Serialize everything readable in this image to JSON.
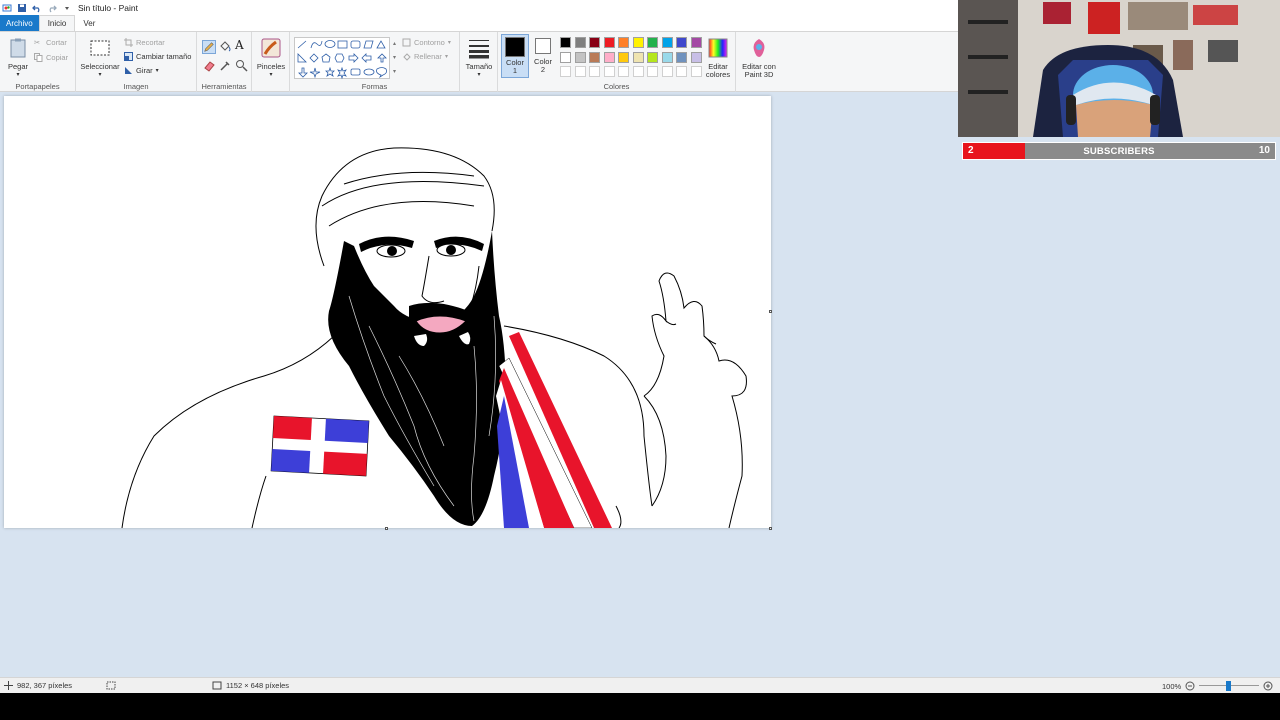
{
  "window": {
    "title": "Sin título - Paint"
  },
  "tabs": [
    {
      "label": "Archivo"
    },
    {
      "label": "Inicio"
    },
    {
      "label": "Ver"
    }
  ],
  "ribbon": {
    "portapapeles": {
      "label": "Portapapeles",
      "paste": "Pegar",
      "cut": "Cortar",
      "copy": "Copiar"
    },
    "imagen": {
      "label": "Imagen",
      "select": "Seleccionar",
      "crop": "Recortar",
      "resize": "Cambiar tamaño",
      "rotate": "Girar"
    },
    "herramientas": {
      "label": "Herramientas"
    },
    "pinceles": {
      "label": "Pinceles"
    },
    "formas": {
      "label": "Formas",
      "outline": "Contorno",
      "fill": "Rellenar"
    },
    "tamano": {
      "label": "Tamaño"
    },
    "color1": {
      "label": "Color",
      "num": "1"
    },
    "color2": {
      "label": "Color",
      "num": "2"
    },
    "colores": {
      "label": "Colores"
    },
    "edit_colors": {
      "line1": "Editar",
      "line2": "colores"
    },
    "paint3d": {
      "line1": "Editar con",
      "line2": "Paint 3D"
    }
  },
  "palette": {
    "row1": [
      "#000000",
      "#7f7f7f",
      "#880015",
      "#ed1c24",
      "#ff7f27",
      "#fff200",
      "#22b14c",
      "#00a2e8",
      "#3f48cc",
      "#a349a4"
    ],
    "row2": [
      "#ffffff",
      "#c3c3c3",
      "#b97a57",
      "#ffaec9",
      "#ffc90e",
      "#efe4b0",
      "#b5e61d",
      "#99d9ea",
      "#7092be",
      "#c8bfe7"
    ],
    "row3": [
      "#ffffff",
      "#ffffff",
      "#ffffff",
      "#ffffff",
      "#ffffff",
      "#ffffff",
      "#ffffff",
      "#ffffff",
      "#ffffff",
      "#ffffff"
    ],
    "color1": "#000000",
    "color2": "#ffffff"
  },
  "status": {
    "cursor_pos": "982, 367 píxeles",
    "canvas_size": "1152 × 648 píxeles",
    "zoom": "100%"
  },
  "subscribers": {
    "current": "2",
    "label": "SUBSCRIBERS",
    "goal": "10",
    "progress": 0.2,
    "fill_color": "#e8141c"
  }
}
